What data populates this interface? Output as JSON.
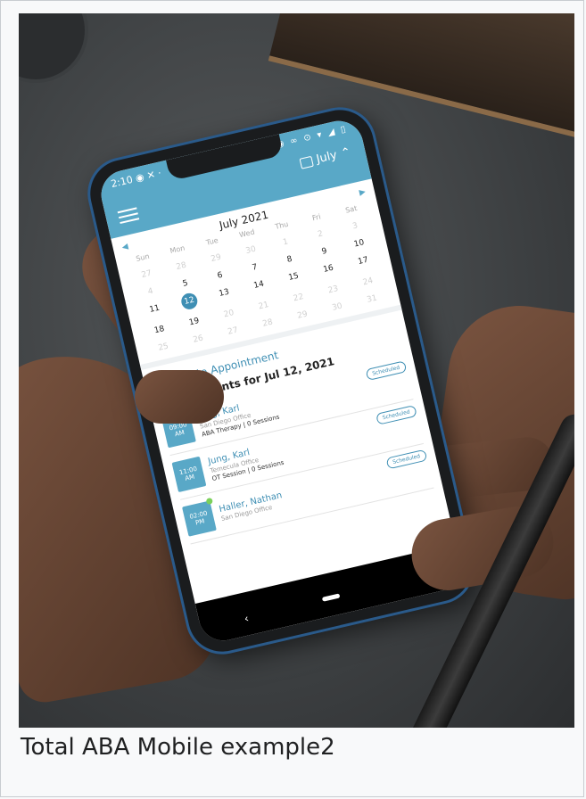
{
  "caption": "Total ABA Mobile example2",
  "app": {
    "status_time": "2:10",
    "status_icons": "◉ ✕ ·",
    "status_right": "◉ ∞ ⊙ ▾ ◢ ▯",
    "header_month": "July",
    "calendar_title": "July  2021",
    "weekdays": [
      "Sun",
      "Mon",
      "Tue",
      "Wed",
      "Thu",
      "Fri",
      "Sat"
    ],
    "days": [
      "27",
      "28",
      "29",
      "30",
      "1",
      "2",
      "3",
      "4",
      "5",
      "6",
      "7",
      "8",
      "9",
      "10",
      "11",
      "12",
      "13",
      "14",
      "15",
      "16",
      "17",
      "18",
      "19",
      "20",
      "21",
      "22",
      "23",
      "24",
      "25",
      "26",
      "27",
      "28",
      "29",
      "30",
      "31"
    ],
    "create_label": "Create Appointment",
    "appointments_title": "Appointments for Jul 12, 2021",
    "appointments": [
      {
        "time": "09:00",
        "ampm": "AM",
        "name": "Jung, Karl",
        "office": "San Diego Office",
        "service": "ABA Therapy | 0 Sessions",
        "status": "Scheduled"
      },
      {
        "time": "11:00",
        "ampm": "AM",
        "name": "Jung, Karl",
        "office": "Temecula Office",
        "service": "OT Session | 0 Sessions",
        "status": "Scheduled"
      },
      {
        "time": "02:00",
        "ampm": "PM",
        "name": "Haller, Nathan",
        "office": "San Diego Office",
        "service": "",
        "status": "Scheduled"
      }
    ],
    "back_glyph": "‹"
  },
  "colors": {
    "accent": "#59a8c7",
    "accent_dark": "#3f8fb4",
    "online_dot": "#7bd05a"
  }
}
